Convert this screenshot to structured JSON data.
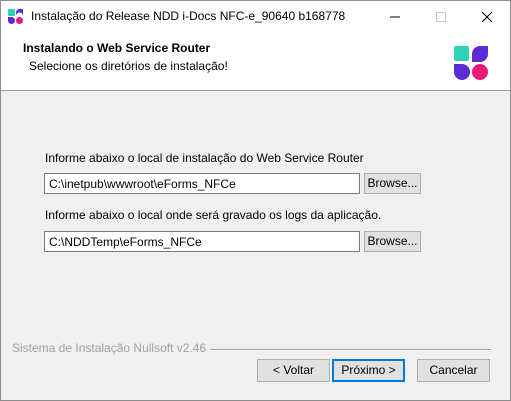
{
  "window": {
    "title": "Instalação do Release NDD i-Docs NFC-e_90640 b168778",
    "controls": {
      "minimize": "minimize-icon",
      "maximize": "maximize-icon",
      "close": "close-icon"
    }
  },
  "header": {
    "title": "Instalando o Web Service Router",
    "subtitle": "Selecione os diretórios de instalação!"
  },
  "main": {
    "router_path": {
      "label": "Informe abaixo o local de instalação do Web Service Router",
      "value": "C:\\inetpub\\wwwroot\\eForms_NFCe",
      "browse_label": "Browse..."
    },
    "logs_path": {
      "label": "Informe abaixo o local onde será gravado os logs da aplicação.",
      "value": "C:\\NDDTemp\\eForms_NFCe",
      "browse_label": "Browse..."
    }
  },
  "footer": {
    "branding": "Sistema de Instalação Nullsoft v2.46",
    "back_label": "< Voltar",
    "next_label": "Próximo >",
    "cancel_label": "Cancelar"
  },
  "colors": {
    "logo_teal": "#2ed3b7",
    "logo_purple": "#5b2bd6",
    "logo_pink": "#e5197a",
    "focus_blue": "#0078d7"
  }
}
